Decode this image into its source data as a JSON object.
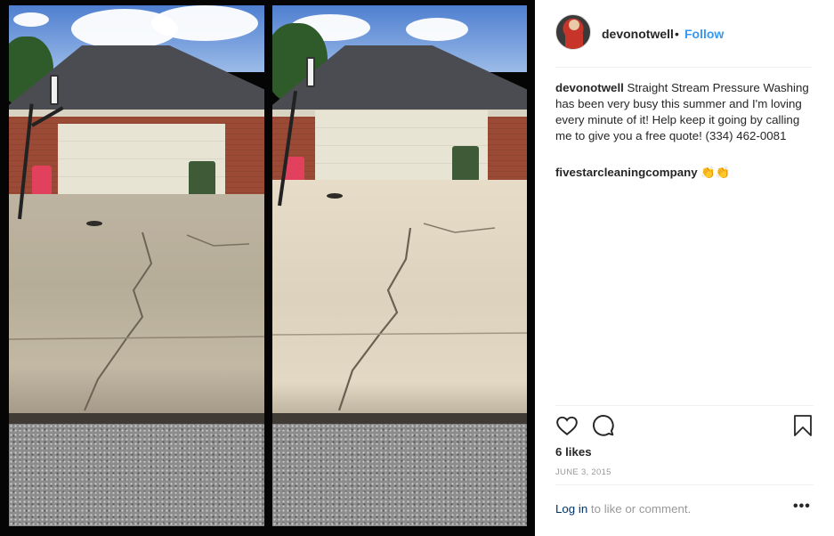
{
  "post": {
    "username": "devonotwell",
    "separator": "•",
    "follow_label": "Follow",
    "caption_username": "devonotwell",
    "caption_text": "Straight Stream Pressure Washing has been very busy this summer and I'm loving every minute of it! Help keep it going by calling me to give you a free quote! (334) 462-0081",
    "tagged_account": "fivestarcleaningcompany",
    "tagged_emoji": "👏👏",
    "likes": "6 likes",
    "date": "JUNE 3, 2015",
    "login_link": "Log in",
    "login_rest": " to like or comment.",
    "more_label": "•••"
  },
  "icons": {
    "like": "heart-icon",
    "comment": "comment-icon",
    "save": "bookmark-icon"
  },
  "colors": {
    "follow_blue": "#3897f0",
    "link_navy": "#003569",
    "muted_gray": "#999999",
    "divider": "#efefef"
  }
}
